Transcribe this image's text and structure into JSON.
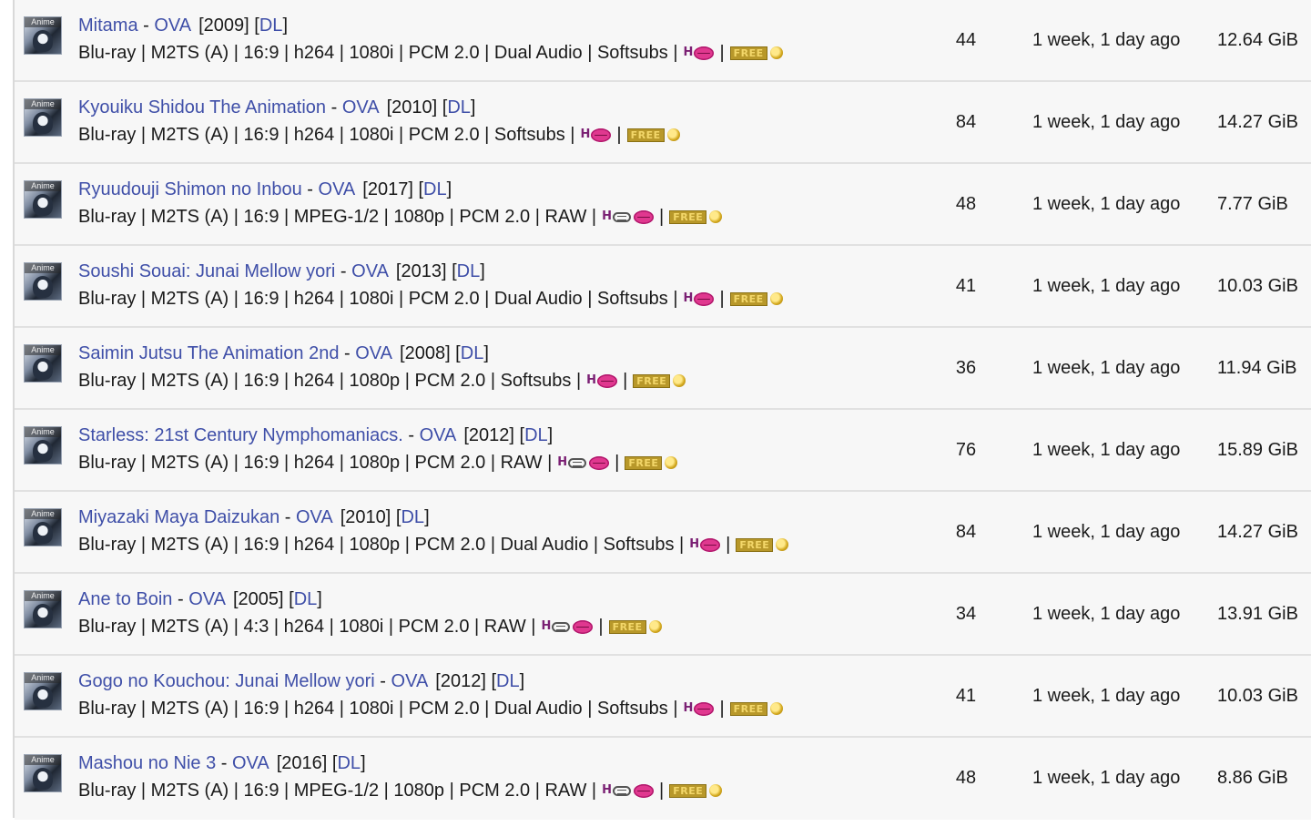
{
  "category": {
    "icon_label": "Anime",
    "icon_name": "anime-category-icon"
  },
  "link_color": "#3f4fa8",
  "tags": {
    "free_label": "FREE"
  },
  "torrents": [
    {
      "title": "Mitama",
      "type": "OVA",
      "year": "[2009]",
      "dl": "DL",
      "details": "Blu-ray | M2TS (A) | 16:9 | h264 | 1080i | PCM 2.0 | Dual Audio | Softsubs |",
      "censored": false,
      "count": "44",
      "age": "1 week, 1 day ago",
      "size": "12.64 GiB"
    },
    {
      "title": "Kyouiku Shidou The Animation",
      "type": "OVA",
      "year": "[2010]",
      "dl": "DL",
      "details": "Blu-ray | M2TS (A) | 16:9 | h264 | 1080i | PCM 2.0 | Softsubs |",
      "censored": false,
      "count": "84",
      "age": "1 week, 1 day ago",
      "size": "14.27 GiB"
    },
    {
      "title": "Ryuudouji Shimon no Inbou",
      "type": "OVA",
      "year": "[2017]",
      "dl": "DL",
      "details": "Blu-ray | M2TS (A) | 16:9 | MPEG-1/2 | 1080p | PCM 2.0 | RAW |",
      "censored": true,
      "count": "48",
      "age": "1 week, 1 day ago",
      "size": "7.77 GiB"
    },
    {
      "title": "Soushi Souai: Junai Mellow yori",
      "type": "OVA",
      "year": "[2013]",
      "dl": "DL",
      "details": "Blu-ray | M2TS (A) | 16:9 | h264 | 1080i | PCM 2.0 | Dual Audio | Softsubs |",
      "censored": false,
      "count": "41",
      "age": "1 week, 1 day ago",
      "size": "10.03 GiB"
    },
    {
      "title": "Saimin Jutsu The Animation 2nd",
      "type": "OVA",
      "year": "[2008]",
      "dl": "DL",
      "details": "Blu-ray | M2TS (A) | 16:9 | h264 | 1080p | PCM 2.0 | Softsubs |",
      "censored": false,
      "count": "36",
      "age": "1 week, 1 day ago",
      "size": "11.94 GiB"
    },
    {
      "title": "Starless: 21st Century Nymphomaniacs.",
      "type": "OVA",
      "year": "[2012]",
      "dl": "DL",
      "details": "Blu-ray | M2TS (A) | 16:9 | h264 | 1080p | PCM 2.0 | RAW |",
      "censored": true,
      "count": "76",
      "age": "1 week, 1 day ago",
      "size": "15.89 GiB"
    },
    {
      "title": "Miyazaki Maya Daizukan",
      "type": "OVA",
      "year": "[2010]",
      "dl": "DL",
      "details": "Blu-ray | M2TS (A) | 16:9 | h264 | 1080p | PCM 2.0 | Dual Audio | Softsubs |",
      "censored": false,
      "count": "84",
      "age": "1 week, 1 day ago",
      "size": "14.27 GiB"
    },
    {
      "title": "Ane to Boin",
      "type": "OVA",
      "year": "[2005]",
      "dl": "DL",
      "details": "Blu-ray | M2TS (A) | 4:3 | h264 | 1080i | PCM 2.0 | RAW |",
      "censored": true,
      "count": "34",
      "age": "1 week, 1 day ago",
      "size": "13.91 GiB"
    },
    {
      "title": "Gogo no Kouchou: Junai Mellow yori",
      "type": "OVA",
      "year": "[2012]",
      "dl": "DL",
      "details": "Blu-ray | M2TS (A) | 16:9 | h264 | 1080i | PCM 2.0 | Dual Audio | Softsubs |",
      "censored": false,
      "count": "41",
      "age": "1 week, 1 day ago",
      "size": "10.03 GiB"
    },
    {
      "title": "Mashou no Nie 3",
      "type": "OVA",
      "year": "[2016]",
      "dl": "DL",
      "details": "Blu-ray | M2TS (A) | 16:9 | MPEG-1/2 | 1080p | PCM 2.0 | RAW |",
      "censored": true,
      "count": "48",
      "age": "1 week, 1 day ago",
      "size": "8.86 GiB"
    }
  ]
}
